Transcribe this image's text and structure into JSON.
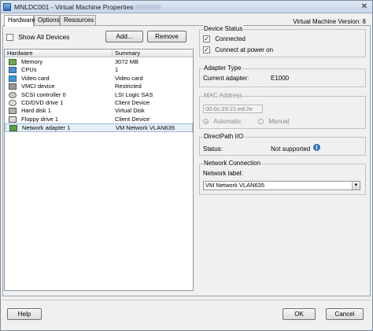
{
  "window": {
    "title": "MNLDC001 - Virtual Machine Properties",
    "close_glyph": "✕"
  },
  "tabs": [
    {
      "label": "Hardware",
      "active": true
    },
    {
      "label": "Options",
      "active": false
    },
    {
      "label": "Resources",
      "active": false
    }
  ],
  "version_label": "Virtual Machine Version: 8",
  "hardware_panel": {
    "show_all_label": "Show All Devices",
    "show_all_checked": false,
    "add_button": "Add...",
    "remove_button": "Remove",
    "columns": [
      "Hardware",
      "Summary"
    ],
    "rows": [
      {
        "icon": "memory-icon",
        "name": "Memory",
        "summary": "3072 MB"
      },
      {
        "icon": "cpu-icon",
        "name": "CPUs",
        "summary": "1"
      },
      {
        "icon": "video-card-icon",
        "name": "Video card",
        "summary": "Video card"
      },
      {
        "icon": "vmci-device-icon",
        "name": "VMCI device",
        "summary": "Restricted"
      },
      {
        "icon": "scsi-controller-icon",
        "name": "SCSI controller 0",
        "summary": "LSI Logic SAS"
      },
      {
        "icon": "cd-dvd-drive-icon",
        "name": "CD/DVD drive 1",
        "summary": "Client Device"
      },
      {
        "icon": "hard-disk-icon",
        "name": "Hard disk 1",
        "summary": "Virtual Disk"
      },
      {
        "icon": "floppy-drive-icon",
        "name": "Floppy drive 1",
        "summary": "Client Device"
      },
      {
        "icon": "network-adapter-icon",
        "name": "Network adapter 1",
        "summary": "VM Network VLAN635",
        "selected": true
      }
    ]
  },
  "device_status": {
    "title": "Device Status",
    "check_glyph": "✓",
    "connected_label": "Connected",
    "connected_checked": true,
    "connect_power_label": "Connect at power on",
    "connect_power_checked": true
  },
  "adapter_type": {
    "title": "Adapter Type",
    "current_label": "Current adapter:",
    "current_value": "E1000"
  },
  "mac_address": {
    "title": "MAC Address",
    "value": "00:0c:29:21:ed:2e",
    "automatic_label": "Automatic",
    "manual_label": "Manual",
    "selected": "Automatic"
  },
  "directpath": {
    "title": "DirectPath I/O",
    "status_label": "Status:",
    "status_value": "Not supported",
    "info_glyph": "i"
  },
  "network_connection": {
    "title": "Network Connection",
    "label": "Network label:",
    "selected_value": "VM Network VLAN635",
    "arrow_glyph": "▼"
  },
  "footer": {
    "help_button": "Help",
    "ok_button": "OK",
    "cancel_button": "Cancel"
  }
}
